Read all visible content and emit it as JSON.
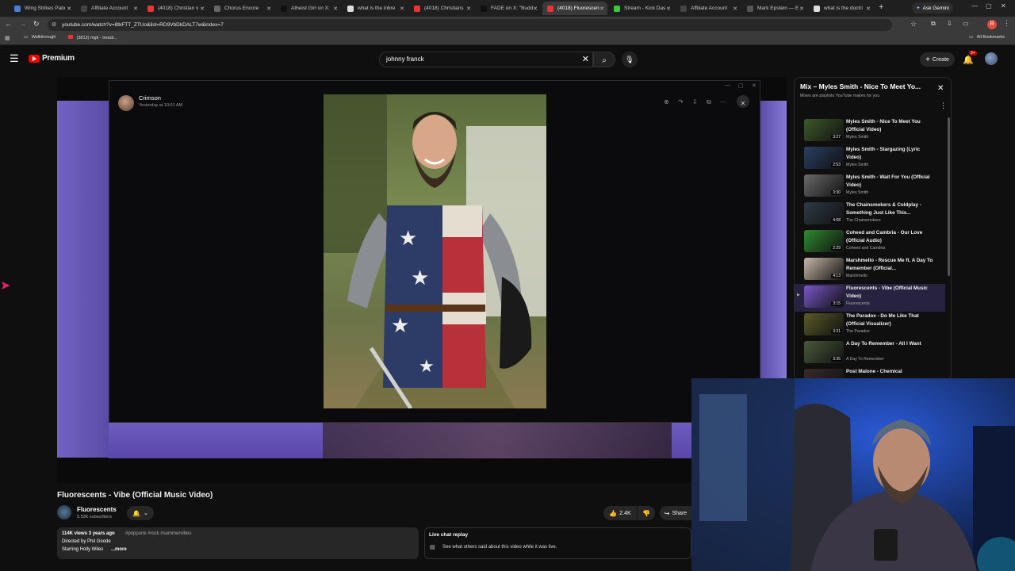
{
  "browser": {
    "tabs": [
      {
        "label": "Wing Strikes Palo",
        "color": "#4a7fd6"
      },
      {
        "label": "Affiliate Account",
        "color": "#444"
      },
      {
        "label": "(4018) Christian v",
        "color": "#e33"
      },
      {
        "label": "Chorus Encore",
        "color": "#666"
      },
      {
        "label": "Atheist Girl on X:",
        "color": "#111"
      },
      {
        "label": "what is the inbre",
        "color": "#ddd"
      },
      {
        "label": "(4018) Christians",
        "color": "#e33"
      },
      {
        "label": "FADE on X: \"Budd",
        "color": "#111"
      },
      {
        "label": "(4018) Fluorescen",
        "color": "#e33"
      },
      {
        "label": "Stream - Kick Das",
        "color": "#3c3"
      },
      {
        "label": "Affiliate Account",
        "color": "#444"
      },
      {
        "label": "Mark Epstein — E",
        "color": "#555"
      },
      {
        "label": "what is the doctri",
        "color": "#ddd"
      }
    ],
    "active_tab_index": 8,
    "new_tab_symbol": "+",
    "ask_gemini": "Ask Gemini",
    "url": "youtube.com/watch?v=8tkFTT_ZTUo&list=RD9VbDkDALT7w&index=7",
    "bookmarks": [
      {
        "label": "Walkthrough"
      },
      {
        "label": "(3813) mgk - treadi..."
      }
    ],
    "all_bookmarks": "All Bookmarks",
    "profile_initial": "R"
  },
  "youtube": {
    "logo_text": "Premium",
    "search_query": "johnny franck",
    "create_label": "Create",
    "notif_count": "9+"
  },
  "overlay": {
    "user": "Crimson",
    "timestamp": "Yesterday at 10:01 AM"
  },
  "video": {
    "title": "Fluorescents - Vibe (Official Music Video)",
    "channel": "Fluorescents",
    "subscribers": "5.53K subscribers",
    "likes": "2.4K",
    "share": "Share",
    "views_line": "114K views  3 years ago",
    "tags": "#poppunk #rock #summervibes",
    "desc_line1": "Directed by Phil Goode",
    "desc_line2": "Starring Holly Wiles",
    "more": "...more",
    "live_chat_title": "Live chat replay",
    "live_chat_desc": "See what others said about this video while it was live."
  },
  "playlist": {
    "title": "Mix – Myles Smith - Nice To Meet Yo...",
    "subtitle": "Mixes are playlists YouTube makes for you",
    "items": [
      {
        "title": "Myles Smith - Nice To Meet You (Official Video)",
        "channel": "Myles Smith",
        "duration": "3:27",
        "thumb": "#3d5a2a"
      },
      {
        "title": "Myles Smith - Stargazing (Lyric Video)",
        "channel": "Myles Smith",
        "duration": "2:53",
        "thumb": "#2a3f63"
      },
      {
        "title": "Myles Smith - Wait For You (Official Video)",
        "channel": "Myles Smith",
        "duration": "3:30",
        "thumb": "#6a6a6a"
      },
      {
        "title": "The Chainsmokers & Coldplay - Something Just Like This...",
        "channel": "The Chainsmokers",
        "duration": "4:08",
        "thumb": "#2e3a46"
      },
      {
        "title": "Coheed and Cambria - Our Love (Official Audio)",
        "channel": "Coheed and Cambria",
        "duration": "2:29",
        "thumb": "#2f8a2f"
      },
      {
        "title": "Marshmello - Rescue Me ft. A Day To Remember (Official...",
        "channel": "Marshmello",
        "duration": "4:13",
        "thumb": "#c8b8a8"
      },
      {
        "title": "Fluorescents - Vibe (Official Music Video)",
        "channel": "Fluorescents",
        "duration": "3:15",
        "thumb": "#7a58c8"
      },
      {
        "title": "The Paradox - Do Me Like That (Official Visualizer)",
        "channel": "The Paradox",
        "duration": "3:31",
        "thumb": "#5a5a2a"
      },
      {
        "title": "A Day To Remember - All I Want",
        "channel": "A Day To Remember",
        "duration": "3:35",
        "thumb": "#4a5a3a"
      },
      {
        "title": "Post Malone - Chemical",
        "channel": "",
        "duration": "",
        "thumb": "#3a2a2a"
      }
    ]
  },
  "colors": {
    "accent_red": "#ff0000",
    "purple": "#6e5cc0"
  }
}
